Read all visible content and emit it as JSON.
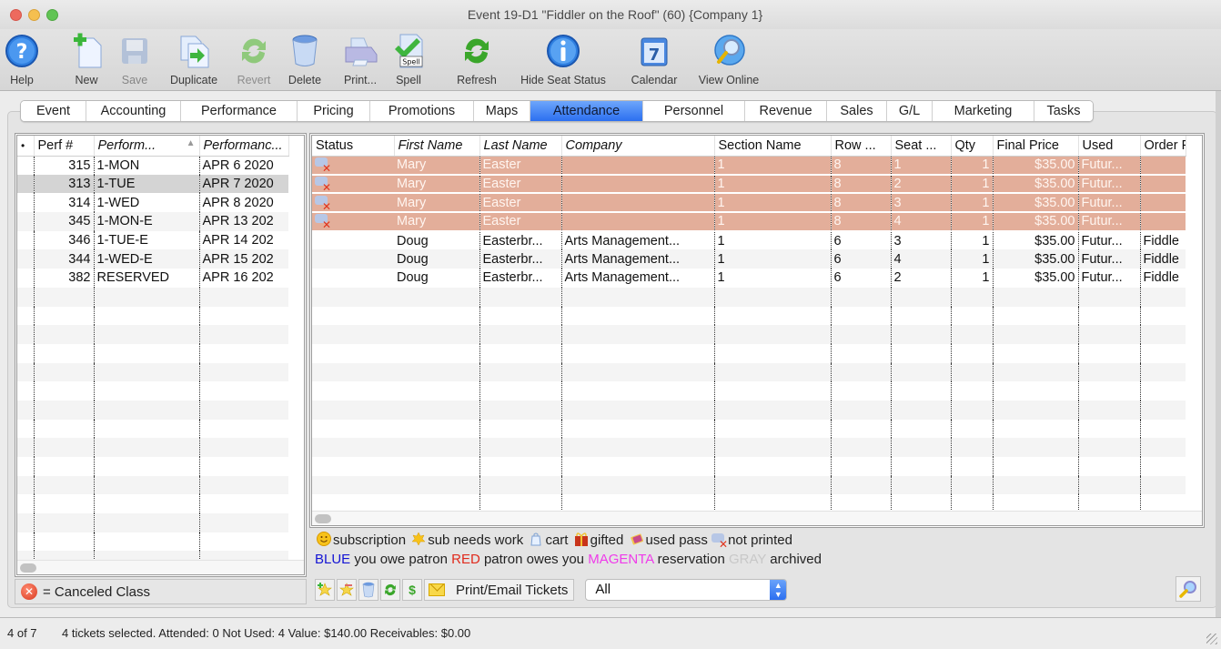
{
  "window": {
    "title": "Event 19-D1 \"Fiddler on the Roof\" (60) {Company 1}"
  },
  "toolbar": {
    "buttons": [
      {
        "label": "Help",
        "icon": "help-icon"
      },
      {
        "label": "New",
        "icon": "new-document-icon"
      },
      {
        "label": "Save",
        "icon": "save-icon"
      },
      {
        "label": "Duplicate",
        "icon": "duplicate-icon"
      },
      {
        "label": "Revert",
        "icon": "revert-icon"
      },
      {
        "label": "Delete",
        "icon": "trash-icon"
      },
      {
        "label": "Print...",
        "icon": "printer-icon"
      },
      {
        "label": "Spell",
        "icon": "spell-check-icon"
      },
      {
        "label": "Refresh",
        "icon": "refresh-icon"
      },
      {
        "label": "Hide Seat Status",
        "icon": "info-icon"
      },
      {
        "label": "Calendar",
        "icon": "calendar-icon"
      },
      {
        "label": "View Online",
        "icon": "globe-search-icon"
      }
    ],
    "spell_badge": "Spell",
    "calendar_day": "7"
  },
  "tabs": [
    {
      "label": "Event"
    },
    {
      "label": "Accounting"
    },
    {
      "label": "Performance"
    },
    {
      "label": "Pricing"
    },
    {
      "label": "Promotions"
    },
    {
      "label": "Maps"
    },
    {
      "label": "Attendance",
      "active": true
    },
    {
      "label": "Personnel"
    },
    {
      "label": "Revenue"
    },
    {
      "label": "Sales"
    },
    {
      "label": "G/L"
    },
    {
      "label": "Marketing"
    },
    {
      "label": "Tasks"
    }
  ],
  "performances": {
    "columns": [
      "•",
      "Perf #",
      "Perform...",
      "Performanc..."
    ],
    "sort_indicator": "▲",
    "rows": [
      {
        "perf": "315",
        "code": "1-MON",
        "date": "APR 6 2020"
      },
      {
        "perf": "313",
        "code": "1-TUE",
        "date": "APR 7 2020",
        "selected": true
      },
      {
        "perf": "314",
        "code": "1-WED",
        "date": "APR 8 2020"
      },
      {
        "perf": "345",
        "code": "1-MON-E",
        "date": "APR 13 202"
      },
      {
        "perf": "346",
        "code": "1-TUE-E",
        "date": "APR 14 202"
      },
      {
        "perf": "344",
        "code": "1-WED-E",
        "date": "APR 15 202"
      },
      {
        "perf": "382",
        "code": "RESERVED",
        "date": "APR 16 202"
      }
    ],
    "legend_label": "= Canceled Class"
  },
  "tickets": {
    "columns": [
      "Status",
      "First Name",
      "Last Name",
      "Company",
      "Section Name",
      "Row ...",
      "Seat ...",
      "Qty",
      "Final Price",
      "Used",
      "Order P"
    ],
    "rows": [
      {
        "status": "not-printed",
        "first": "Mary",
        "last": "Easter",
        "company": "",
        "section": "1",
        "row": "8",
        "seat": "1",
        "qty": "1",
        "price": "$35.00",
        "used": "Futur...",
        "order": "",
        "selected": true
      },
      {
        "status": "not-printed",
        "first": "Mary",
        "last": "Easter",
        "company": "",
        "section": "1",
        "row": "8",
        "seat": "2",
        "qty": "1",
        "price": "$35.00",
        "used": "Futur...",
        "order": "",
        "selected": true
      },
      {
        "status": "not-printed",
        "first": "Mary",
        "last": "Easter",
        "company": "",
        "section": "1",
        "row": "8",
        "seat": "3",
        "qty": "1",
        "price": "$35.00",
        "used": "Futur...",
        "order": "",
        "selected": true
      },
      {
        "status": "not-printed",
        "first": "Mary",
        "last": "Easter",
        "company": "",
        "section": "1",
        "row": "8",
        "seat": "4",
        "qty": "1",
        "price": "$35.00",
        "used": "Futur...",
        "order": "",
        "selected": true
      },
      {
        "status": "",
        "first": "Doug",
        "last": "Easterbr...",
        "company": "Arts Management...",
        "section": "1",
        "row": "6",
        "seat": "3",
        "qty": "1",
        "price": "$35.00",
        "used": "Futur...",
        "order": "Fiddle"
      },
      {
        "status": "",
        "first": "Doug",
        "last": "Easterbr...",
        "company": "Arts Management...",
        "section": "1",
        "row": "6",
        "seat": "4",
        "qty": "1",
        "price": "$35.00",
        "used": "Futur...",
        "order": "Fiddle"
      },
      {
        "status": "",
        "first": "Doug",
        "last": "Easterbr...",
        "company": "Arts Management...",
        "section": "1",
        "row": "6",
        "seat": "2",
        "qty": "1",
        "price": "$35.00",
        "used": "Futur...",
        "order": "Fiddle"
      }
    ]
  },
  "legend": {
    "icons": [
      {
        "icon": "smiley-icon",
        "label": "subscription"
      },
      {
        "icon": "sub-needs-work-icon",
        "label": "sub needs work"
      },
      {
        "icon": "cart-icon",
        "label": "cart"
      },
      {
        "icon": "gift-icon",
        "label": "gifted"
      },
      {
        "icon": "used-pass-icon",
        "label": "used pass"
      },
      {
        "icon": "not-printed-icon",
        "label": "not printed"
      }
    ],
    "colors": [
      {
        "word": "BLUE",
        "desc": "you owe patron",
        "color": "#1414d4"
      },
      {
        "word": "RED",
        "desc": "patron owes you",
        "color": "#e02a1c"
      },
      {
        "word": "MAGENTA",
        "desc": "reservation",
        "color": "#ef3bea"
      },
      {
        "word": "GRAY",
        "desc": "archived",
        "color": "#c8c8c8"
      }
    ]
  },
  "actions": {
    "print_email_label": "Print/Email Tickets",
    "filter_value": "All"
  },
  "status_bar": {
    "count": "4 of 7",
    "message": "4 tickets selected.  Attended: 0 Not Used: 4  Value: $140.00 Receivables: $0.00"
  },
  "colors": {
    "selected_row": "#e3ae9a",
    "active_tab": "#2b6ff0"
  }
}
